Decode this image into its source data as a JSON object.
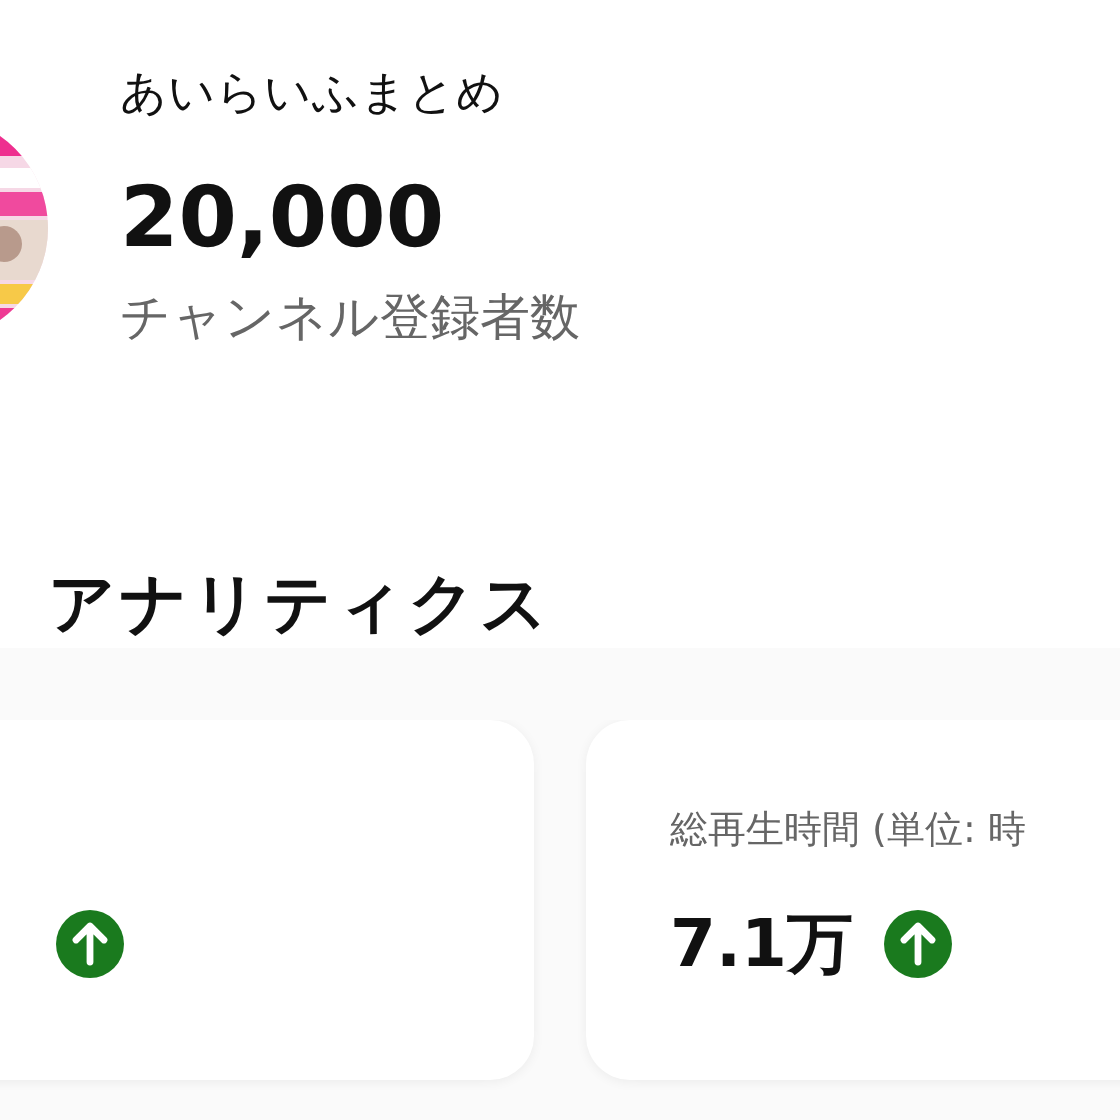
{
  "channel": {
    "name": "あいらいふまとめ",
    "subscriber_count": "20,000",
    "subscriber_label": "チャンネル登録者数"
  },
  "analytics": {
    "title": "アナリティクス",
    "cards": [
      {
        "trend_up": true
      },
      {
        "label": "総再生時間 (単位: 時",
        "value": "7.1万",
        "trend_up": true
      }
    ]
  }
}
